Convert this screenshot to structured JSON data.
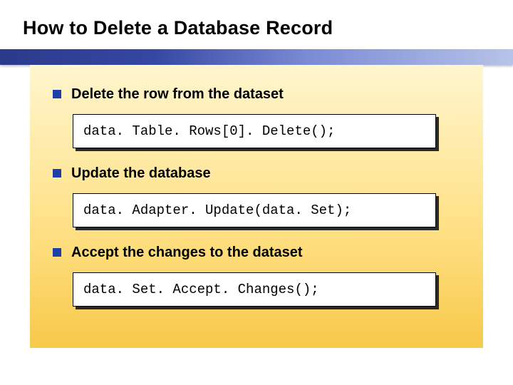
{
  "title": "How to Delete a Database Record",
  "items": [
    {
      "label": "Delete the row from the dataset",
      "code": "data. Table. Rows[0]. Delete();"
    },
    {
      "label": "Update the database",
      "code": "data. Adapter. Update(data. Set);"
    },
    {
      "label": "Accept the changes to the dataset",
      "code": "data. Set. Accept. Changes();"
    }
  ]
}
